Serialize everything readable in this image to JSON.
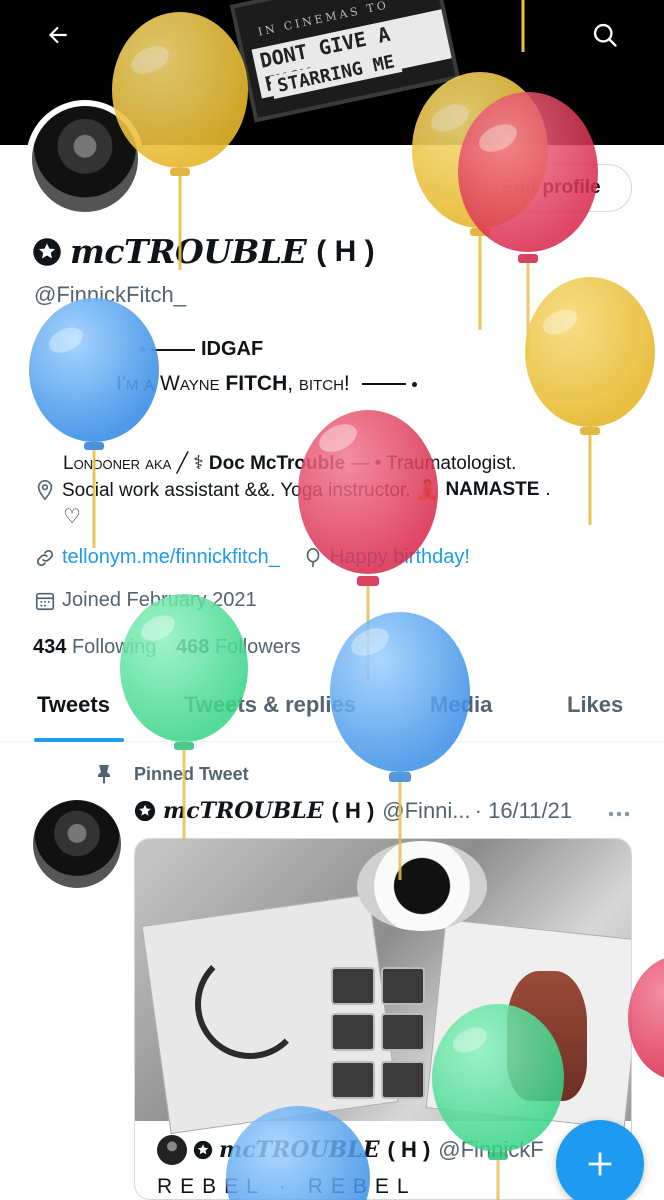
{
  "banner": {
    "marquee_top": "IN CINEMAS TO",
    "marquee_line1": "DONT GIVE A FUCK",
    "marquee_line2": "STARRING ME"
  },
  "header": {
    "back_icon": "arrow-left-icon",
    "search_icon": "search-icon"
  },
  "profile": {
    "edit_button": "Edit profile",
    "display_name": "mcTROUBLE",
    "name_suffix": "( H )",
    "handle": "@FinnickFitch_",
    "bio_line1": "IDGAF",
    "bio_line2_pre": "I'm a Wayne",
    "bio_line2_bold": "FITCH",
    "bio_line2_post": ", bitch!",
    "bio_line3_pre": "Londoner aka",
    "bio_line3_sep": "╱",
    "bio_line3_bold": "Doc McTrouble",
    "bio_line3_post": "— • Traumatologist.",
    "location_text": "Social work assistant &&. Yoga instructor. 🧘",
    "location_bold": "NAMASTE",
    "location_end": ".",
    "heart": "♡",
    "link": "tellonym.me/finnickfitch_",
    "birthday": "Happy birthday!",
    "joined": "Joined February 2021",
    "following_count": "434",
    "following_label": "Following",
    "followers_count": "468",
    "followers_label": "Followers"
  },
  "tabs": [
    {
      "label": "Tweets",
      "active": true
    },
    {
      "label": "Tweets & replies",
      "active": false
    },
    {
      "label": "Media",
      "active": false
    },
    {
      "label": "Likes",
      "active": false
    }
  ],
  "tweet": {
    "pinned_label": "Pinned Tweet",
    "author_name": "mcTROUBLE",
    "author_suffix": "( H )",
    "author_handle": "@Finni...",
    "date": "· 16/11/21",
    "more_icon": "more-icon",
    "quote_author_name": "mcTROUBLE",
    "quote_author_suffix": "( H )",
    "quote_author_handle": "@FinnickF",
    "quote_text": "REBEL · REBEL"
  },
  "fab": {
    "icon": "plus-icon"
  },
  "colors": {
    "accent": "#1d9bf0",
    "secondary_text": "#536471",
    "balloon_yellow": "#f2c94c",
    "balloon_red": "#e8425f",
    "balloon_blue": "#5aa8ee",
    "balloon_green": "#5fe0a0"
  }
}
